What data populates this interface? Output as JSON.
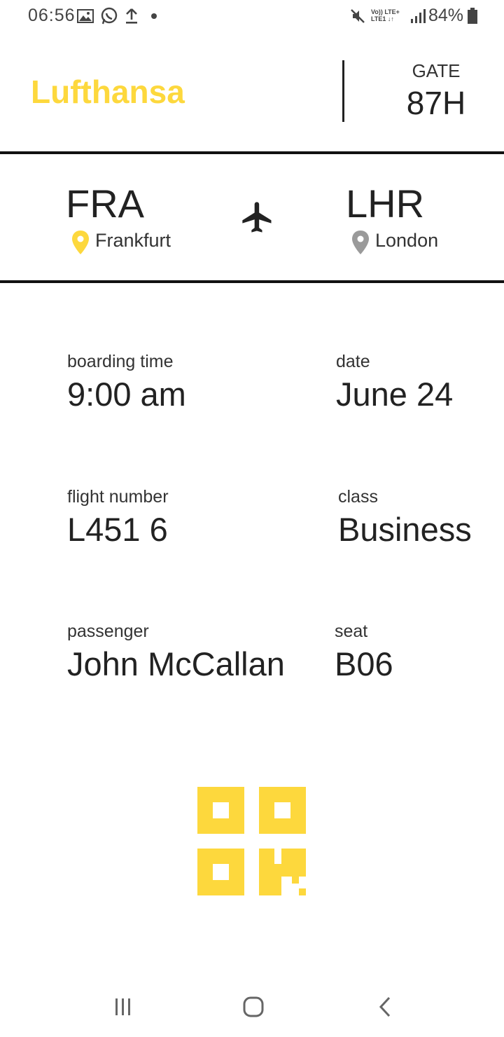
{
  "status_bar": {
    "time": "06:56",
    "network_top": "Vo)) LTE+",
    "network_bottom": "LTE1 ↓↑",
    "battery": "84%",
    "icons": [
      "image-icon",
      "whatsapp-icon",
      "upload-icon",
      "dot-icon",
      "mute-icon",
      "signal-icon",
      "battery-icon"
    ]
  },
  "header": {
    "airline": "Lufthansa",
    "gate_label": "GATE",
    "gate_value": "87H"
  },
  "route": {
    "origin_code": "FRA",
    "origin_city": "Frankfurt",
    "destination_code": "LHR",
    "destination_city": "London"
  },
  "details": {
    "boarding_time_label": "boarding time",
    "boarding_time_value": "9:00 am",
    "date_label": "date",
    "date_value": "June 24",
    "flight_number_label": "flight number",
    "flight_number_value": "L451 6",
    "class_label": "class",
    "class_value": "Business",
    "passenger_label": "passenger",
    "passenger_value": "John McCallan",
    "seat_label": "seat",
    "seat_value": "B06"
  },
  "colors": {
    "brand_yellow": "#fdd83d",
    "pin_origin": "#fdd83d",
    "pin_destination": "#9a9a9a",
    "text_dark": "#222222"
  },
  "nav": {
    "icons": [
      "recent-apps-icon",
      "home-icon",
      "back-icon"
    ]
  }
}
